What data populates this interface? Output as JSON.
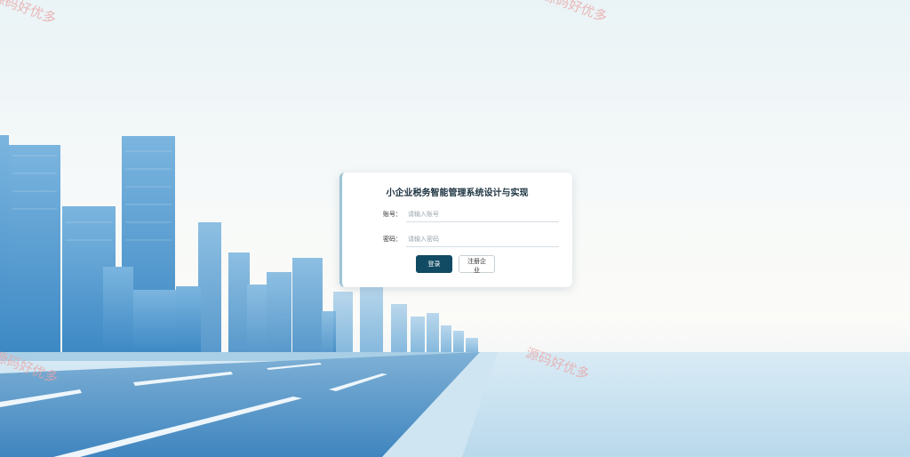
{
  "login": {
    "title": "小企业税务智能管理系统设计与实现",
    "account_label": "账号：",
    "account_placeholder": "请输入账号",
    "password_label": "密码：",
    "password_placeholder": "请输入密码",
    "login_button": "登录",
    "register_button": "注册企业"
  },
  "watermarks": [
    "源码好优多",
    "源码好优多",
    "源码好优多",
    "源码好优多"
  ],
  "colors": {
    "primary_button": "#104a63",
    "title_text": "#1c3340",
    "accent_border": "#9ec3d5",
    "watermark": "#e9a3a3"
  }
}
